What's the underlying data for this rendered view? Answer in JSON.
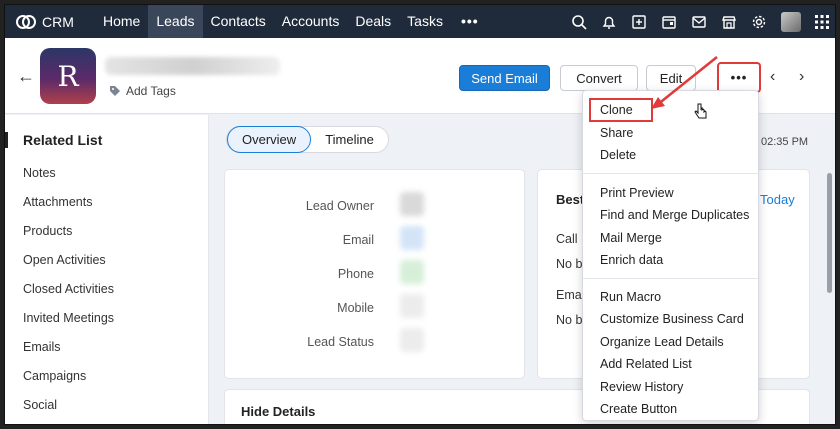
{
  "nav": {
    "brand": "CRM",
    "tabs": [
      "Home",
      "Leads",
      "Contacts",
      "Accounts",
      "Deals",
      "Tasks"
    ],
    "active_tab": "Leads",
    "more": "•••",
    "icons": [
      "search-icon",
      "bell-icon",
      "add-note-icon",
      "calendar-icon",
      "mail-icon",
      "store-icon",
      "gear-icon",
      "avatar",
      "apps-grid-icon"
    ]
  },
  "record": {
    "avatar_letter": "R",
    "add_tags": "Add Tags",
    "send_email": "Send Email",
    "convert": "Convert",
    "edit": "Edit",
    "more": "•••"
  },
  "sidebar": {
    "title": "Related List",
    "items": [
      "Notes",
      "Attachments",
      "Products",
      "Open Activities",
      "Closed Activities",
      "Invited Meetings",
      "Emails",
      "Campaigns",
      "Social"
    ]
  },
  "main": {
    "tabs": [
      "Overview",
      "Timeline"
    ],
    "active_tab": "Overview",
    "timestamp": "02:35 PM",
    "fields": [
      "Lead Owner",
      "Email",
      "Phone",
      "Mobile",
      "Lead Status"
    ],
    "card2": {
      "title": "Best",
      "today": "Today",
      "call": "Call",
      "no_best_1": "No be",
      "email": "Emai",
      "no_best_2": "No be"
    },
    "hide_details": "Hide Details"
  },
  "menu": {
    "group1": [
      "Clone",
      "Share",
      "Delete"
    ],
    "group2": [
      "Print Preview",
      "Find and Merge Duplicates",
      "Mail Merge",
      "Enrich data"
    ],
    "group3": [
      "Run Macro",
      "Customize Business Card",
      "Organize Lead Details",
      "Add Related List",
      "Review History",
      "Create Button"
    ]
  },
  "colors": {
    "accent": "#1a7dd8",
    "highlight": "#e03a3a",
    "nav_bg": "#1f2a3a"
  }
}
